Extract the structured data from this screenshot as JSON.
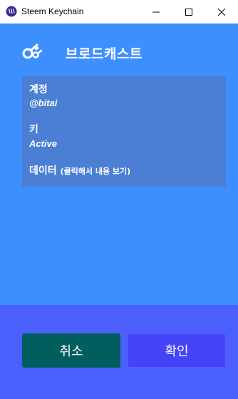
{
  "window": {
    "title": "Steem Keychain",
    "minimize_icon": "minimize-icon",
    "maximize_icon": "maximize-icon",
    "close_icon": "close-icon"
  },
  "header": {
    "icon": "key-icon",
    "title": "브로드캐스트"
  },
  "fields": {
    "account_label": "계정",
    "account_value": "@bitai",
    "key_label": "키",
    "key_value": "Active",
    "data_label": "데이터",
    "data_hint": "(클릭해서 내용 보기)"
  },
  "buttons": {
    "cancel": "취소",
    "confirm": "확인"
  },
  "colors": {
    "background": "#3d8ffe",
    "info_box": "#4a7fd4",
    "footer": "#4b5ffc",
    "cancel_button": "#005e5e",
    "confirm_button": "#4443f8"
  }
}
